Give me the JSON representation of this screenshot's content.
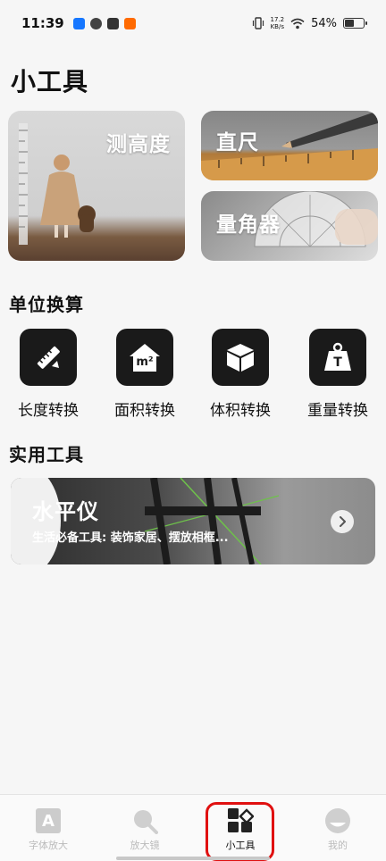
{
  "status_bar": {
    "time": "11:39",
    "net_speed_value": "17.2",
    "net_speed_unit": "KB/s",
    "battery_percent_label": "54%",
    "battery_level": 0.54
  },
  "page": {
    "title": "小工具"
  },
  "feature_cards": {
    "height": {
      "label": "测高度"
    },
    "ruler": {
      "label": "直尺"
    },
    "angle": {
      "label": "量角器"
    }
  },
  "unit_conversion": {
    "title": "单位换算",
    "items": [
      {
        "label": "长度转换",
        "icon": "ruler-pencil-icon"
      },
      {
        "label": "面积转换",
        "icon": "house-area-icon",
        "icon_text": "m²"
      },
      {
        "label": "体积转换",
        "icon": "cube-icon"
      },
      {
        "label": "重量转换",
        "icon": "weight-icon",
        "icon_text": "T"
      }
    ]
  },
  "practical_tools": {
    "title": "实用工具",
    "level": {
      "title": "水平仪",
      "subtitle": "生活必备工具: 装饰家居、摆放相框..."
    }
  },
  "tab_bar": {
    "tabs": [
      {
        "label": "字体放大",
        "icon": "font-enlarge-icon",
        "icon_text": "A"
      },
      {
        "label": "放大镜",
        "icon": "magnifier-icon"
      },
      {
        "label": "小工具",
        "icon": "widgets-icon",
        "active": true
      },
      {
        "label": "我的",
        "icon": "profile-icon"
      }
    ],
    "highlight_color": "#e01010"
  }
}
